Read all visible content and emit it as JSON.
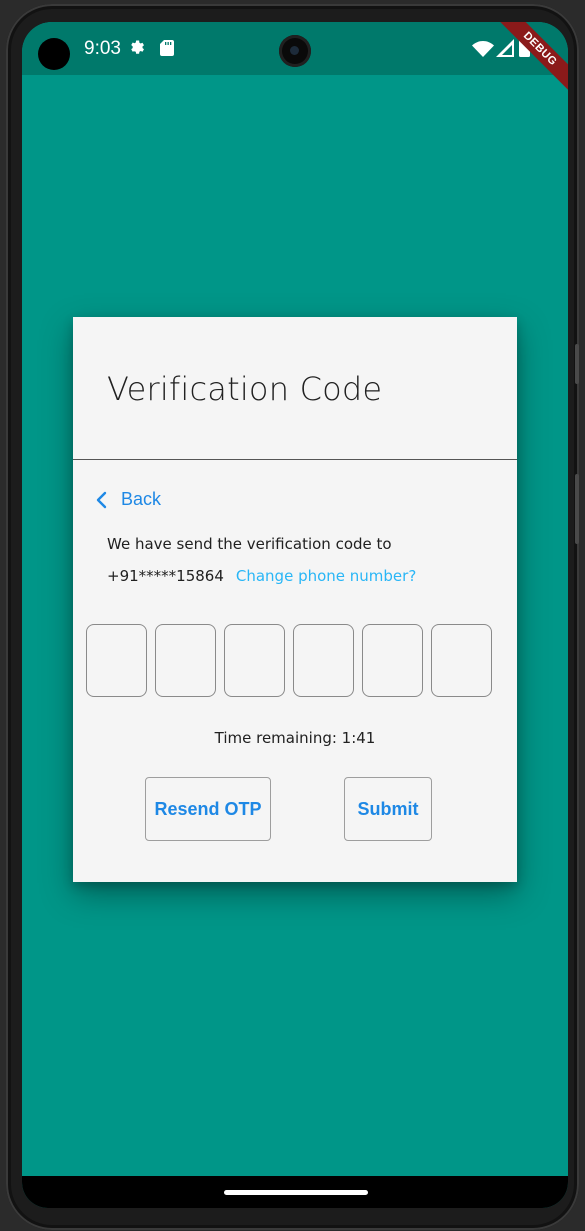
{
  "status_bar": {
    "time": "9:03",
    "icons": [
      "gear-icon",
      "sd-card-icon",
      "wifi-icon",
      "signal-icon",
      "battery-icon"
    ],
    "debug_label": "DEBUG"
  },
  "dialog": {
    "title": "Verification Code",
    "back_label": "Back",
    "info_text": "We have send the verification code to",
    "phone": "+91*****15864",
    "change_phone_link": "Change phone number?",
    "otp_digits": [
      "",
      "",
      "",
      "",
      "",
      ""
    ],
    "timer_text": "Time remaining: 1:41",
    "resend_label": "Resend OTP",
    "submit_label": "Submit"
  },
  "colors": {
    "background": "#009688",
    "status_bar": "#00796b",
    "accent": "#1e88e5",
    "link": "#29b6f6",
    "card": "#f5f5f5"
  }
}
